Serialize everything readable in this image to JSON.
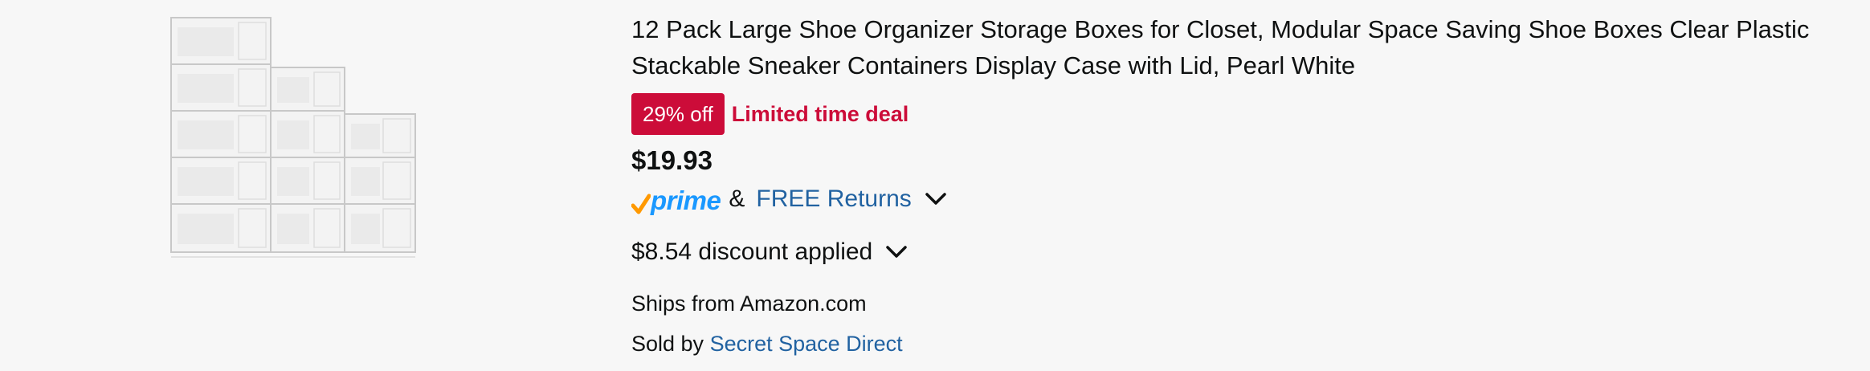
{
  "product": {
    "image_icon": "shoe-organizer-boxes-image",
    "title": "12 Pack Large Shoe Organizer Storage Boxes for Closet, Modular Space Saving Shoe Boxes Clear Plastic Stackable Sneaker Containers Display Case with Lid, Pearl White",
    "deal_badge": "29% off",
    "deal_label": "Limited time deal",
    "price": "$19.93",
    "prime_label": "prime",
    "amp": "&",
    "free_returns": "FREE Returns",
    "discount_text": "$8.54 discount applied",
    "ships_from": "Ships from Amazon.com",
    "sold_by_prefix": "Sold by",
    "seller": "Secret Space Direct"
  },
  "colors": {
    "deal_red": "#cc0c39",
    "link_blue": "#2162a1",
    "prime_blue": "#1a98ff",
    "prime_check_orange": "#ff9900",
    "background": "#f7f7f7"
  }
}
